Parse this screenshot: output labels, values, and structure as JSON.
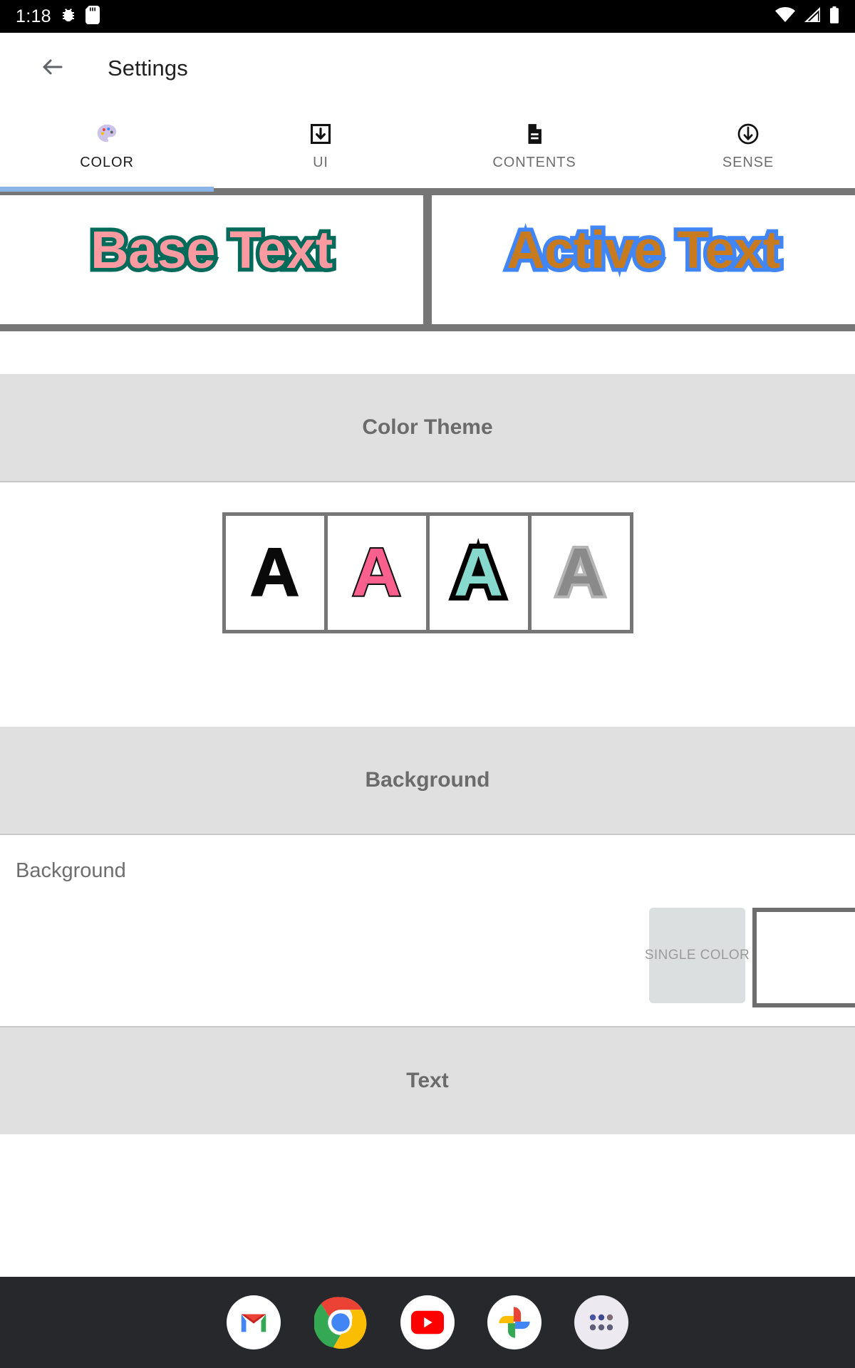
{
  "statusbar": {
    "time": "1:18",
    "icons_left": [
      "bug-icon",
      "sd-card-icon"
    ],
    "icons_right": [
      "wifi-icon",
      "cell-signal-icon",
      "battery-icon"
    ]
  },
  "appbar": {
    "back_icon": "back-arrow-icon",
    "title": "Settings"
  },
  "tabs": {
    "selected_index": 0,
    "indicator_color": "#8ab4e6",
    "items": [
      {
        "label": "COLOR",
        "icon": "palette-icon"
      },
      {
        "label": "UI",
        "icon": "system-update-icon"
      },
      {
        "label": "CONTENTS",
        "icon": "document-icon"
      },
      {
        "label": "SENSE",
        "icon": "circle-down-arrow-icon"
      }
    ]
  },
  "preview": {
    "base": {
      "text": "Base Text",
      "fill_color": "#fb9aa1",
      "stroke_color": "#046b5a"
    },
    "active": {
      "text": "Active Text",
      "fill_color": "#c87a1e",
      "stroke_color": "#4286f5"
    }
  },
  "sections": {
    "color_theme": {
      "title": "Color Theme"
    },
    "background": {
      "title": "Background"
    },
    "text": {
      "title": "Text"
    }
  },
  "color_theme": {
    "swatches": [
      {
        "letter": "A",
        "fill": "#0a0a0a",
        "stroke": "#0a0a0a"
      },
      {
        "letter": "A",
        "fill": "#f9608e",
        "stroke": "#111111"
      },
      {
        "letter": "A",
        "fill": "#87d8cd",
        "stroke": "#000000"
      },
      {
        "letter": "A",
        "fill": "#8a8a8a",
        "stroke": "#b4b4b4"
      }
    ]
  },
  "background_pref": {
    "label": "Background",
    "single_color_button": "SINGLE COLOR",
    "swatch_color": "#ffffff"
  },
  "dock": {
    "apps": [
      {
        "name": "gmail-icon",
        "label": "Gmail"
      },
      {
        "name": "chrome-icon",
        "label": "Chrome"
      },
      {
        "name": "youtube-icon",
        "label": "YouTube"
      },
      {
        "name": "google-photos-icon",
        "label": "Photos"
      },
      {
        "name": "app-drawer-icon",
        "label": "All apps"
      }
    ]
  }
}
